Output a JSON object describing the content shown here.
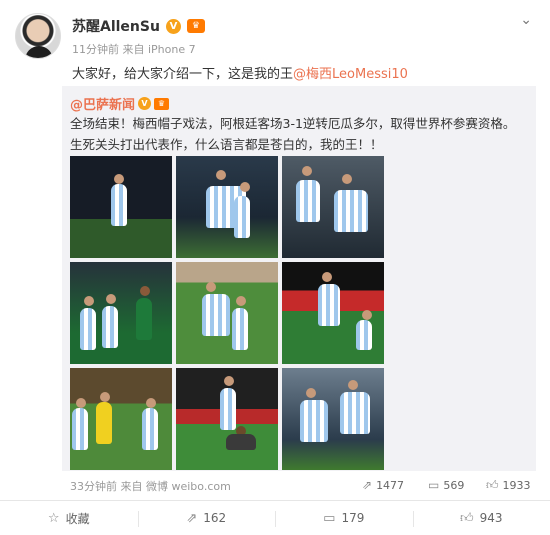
{
  "header": {
    "username": "苏醒AllenSu",
    "meta": "11分钟前 来自 iPhone 7",
    "v_badge": "V",
    "crown_badge": "♛",
    "menu_icon": "chevron-down-icon"
  },
  "post": {
    "text_prefix": "大家好，给大家介绍一下，这是我的王",
    "mention": "@梅西LeoMessi10"
  },
  "repost": {
    "author": "@巴萨新闻",
    "v_badge": "V",
    "crown_badge": "♛",
    "text": "全场结束！梅西帽子戏法，阿根廷客场3-1逆转厄瓜多尔，取得世界杯参赛资格。生死关头打出代表作，什么语言都是苍白的，我的王！！",
    "footer": "33分钟前 来自 微博 weibo.com",
    "stats": {
      "forward": "1477",
      "comment": "569",
      "like": "1933"
    }
  },
  "actions": {
    "favorite": "收藏",
    "forward": "162",
    "comment": "179",
    "like": "943"
  },
  "colors": {
    "mention": "#eb7350",
    "meta": "#999999",
    "repost_bg": "#f2f2f5"
  }
}
